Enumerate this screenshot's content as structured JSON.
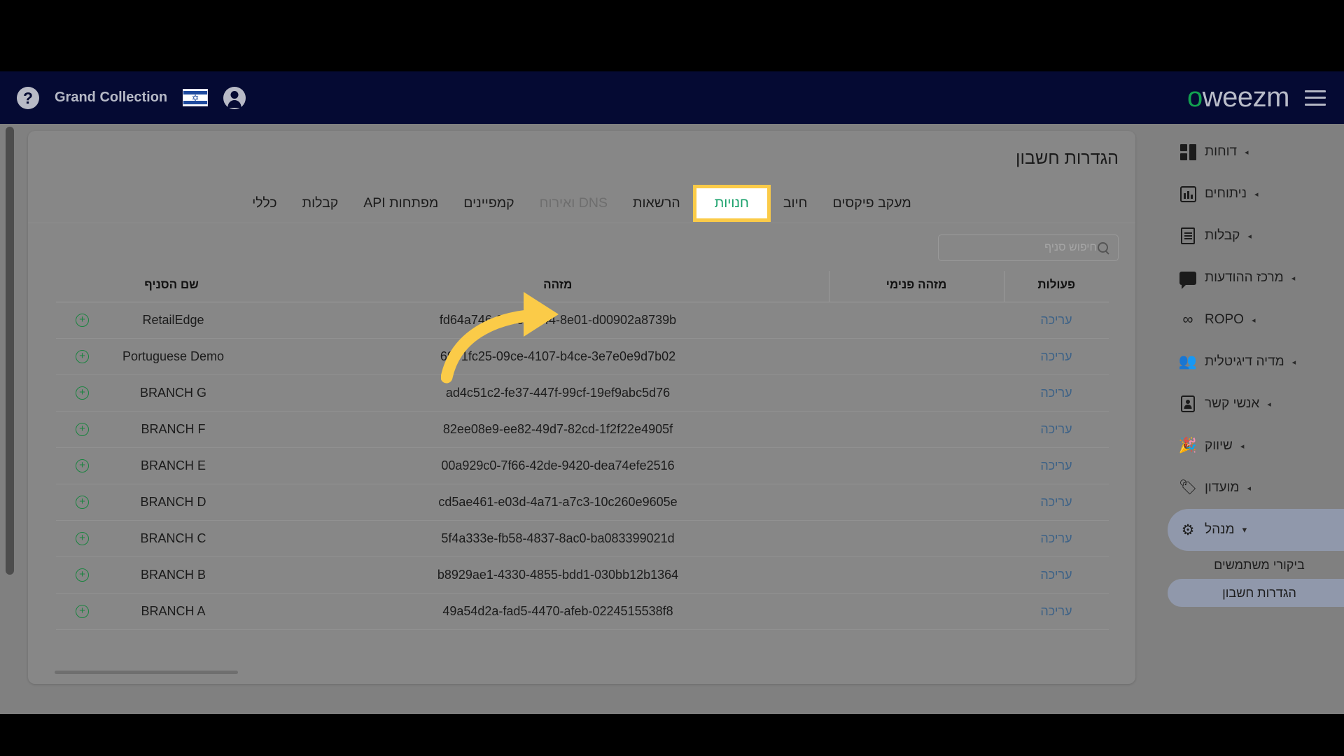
{
  "topbar": {
    "brand": "weezmo",
    "brand_main": "weezm",
    "brand_mark": "o",
    "account_name": "Grand Collection",
    "menu_icon": "hamburger-icon",
    "avatar_icon": "account-circle-icon",
    "flag_icon": "israel-flag-icon",
    "help_icon": "?",
    "background": "#050a33"
  },
  "sidebar": {
    "items": [
      {
        "label": "דוחות",
        "icon": "reports-grid-icon",
        "caret": "◂",
        "expanded": false,
        "active": false
      },
      {
        "label": "ניתוחים",
        "icon": "analytics-chart-icon",
        "caret": "◂",
        "expanded": false,
        "active": false
      },
      {
        "label": "קבלות",
        "icon": "receipts-icon",
        "caret": "◂",
        "expanded": false,
        "active": false
      },
      {
        "label": "מרכז ההודעות",
        "icon": "messages-chat-icon",
        "caret": "◂",
        "expanded": false,
        "active": false
      },
      {
        "label": "ROPO",
        "icon": "infinity-icon",
        "caret": "◂",
        "expanded": false,
        "active": false
      },
      {
        "label": "מדיה דיגיטלית",
        "icon": "digital-media-icon",
        "caret": "◂",
        "expanded": false,
        "active": false
      },
      {
        "label": "אנשי קשר",
        "icon": "contacts-card-icon",
        "caret": "◂",
        "expanded": false,
        "active": false
      },
      {
        "label": "שיווק",
        "icon": "marketing-megaphone-icon",
        "caret": "◂",
        "expanded": false,
        "active": false
      },
      {
        "label": "מועדון",
        "icon": "club-tag-icon",
        "caret": "◂",
        "expanded": false,
        "active": false
      },
      {
        "label": "מנהל",
        "icon": "admin-gear-icon",
        "caret": "▾",
        "expanded": true,
        "active": true
      }
    ],
    "subitems": [
      {
        "label": "ביקורי משתמשים",
        "active": false
      },
      {
        "label": "הגדרות חשבון",
        "active": true
      }
    ]
  },
  "main": {
    "title": "הגדרות חשבון",
    "tabs": [
      {
        "label": "מעקב פיקסים",
        "state": "normal",
        "name": "tab-pixel-tracking"
      },
      {
        "label": "חיוב",
        "state": "normal",
        "name": "tab-billing"
      },
      {
        "label": "חנויות",
        "state": "selected",
        "name": "tab-stores"
      },
      {
        "label": "הרשאות",
        "state": "normal",
        "name": "tab-permissions"
      },
      {
        "label": "DNS ואירוח",
        "state": "disabled",
        "name": "tab-dns-hosting"
      },
      {
        "label": "קמפיינים",
        "state": "normal",
        "name": "tab-campaigns"
      },
      {
        "label": "מפתחות API",
        "state": "normal",
        "name": "tab-api-keys"
      },
      {
        "label": "קבלות",
        "state": "normal",
        "name": "tab-receipts"
      },
      {
        "label": "כללי",
        "state": "normal",
        "name": "tab-general"
      }
    ],
    "search": {
      "value": "",
      "placeholder": "חיפוש סניף",
      "icon": "search-icon"
    },
    "table": {
      "columns": [
        "פעולות",
        "מזהה פנימי",
        "מזהה",
        "שם הסניף"
      ],
      "rows": [
        {
          "action": "עריכה",
          "inner_id": "",
          "id": "fd64a746-38c6-4744-8e01-d00902a8739b",
          "name": "RetailEdge",
          "expand": "＋"
        },
        {
          "action": "עריכה",
          "inner_id": "",
          "id": "6971fc25-09ce-4107-b4ce-3e7e0e9d7b02",
          "name": "Portuguese Demo",
          "expand": "＋"
        },
        {
          "action": "עריכה",
          "inner_id": "",
          "id": "ad4c51c2-fe37-447f-99cf-19ef9abc5d76",
          "name": "BRANCH G",
          "expand": "＋"
        },
        {
          "action": "עריכה",
          "inner_id": "",
          "id": "82ee08e9-ee82-49d7-82cd-1f2f22e4905f",
          "name": "BRANCH F",
          "expand": "＋"
        },
        {
          "action": "עריכה",
          "inner_id": "",
          "id": "00a929c0-7f66-42de-9420-dea74efe2516",
          "name": "BRANCH E",
          "expand": "＋"
        },
        {
          "action": "עריכה",
          "inner_id": "",
          "id": "cd5ae461-e03d-4a71-a7c3-10c260e9605e",
          "name": "BRANCH D",
          "expand": "＋"
        },
        {
          "action": "עריכה",
          "inner_id": "",
          "id": "5f4a333e-fb58-4837-8ac0-ba083399021d",
          "name": "BRANCH C",
          "expand": "＋"
        },
        {
          "action": "עריכה",
          "inner_id": "",
          "id": "b8929ae1-4330-4855-bdd1-030bb12b1364",
          "name": "BRANCH B",
          "expand": "＋"
        },
        {
          "action": "עריכה",
          "inner_id": "",
          "id": "49a54d2a-fad5-4470-afeb-0224515538f8",
          "name": "BRANCH A",
          "expand": "＋"
        }
      ]
    }
  },
  "annotation": {
    "arrow_color": "#fbcb48",
    "highlight_color": "#fbcb48",
    "selected_tab_text_color": "#18a06a"
  }
}
